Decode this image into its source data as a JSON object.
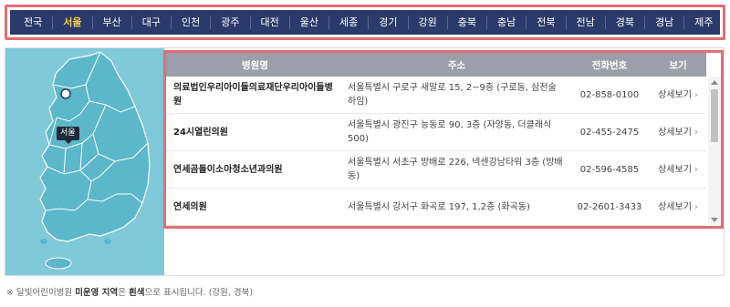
{
  "regions": {
    "tabs": [
      "전국",
      "서울",
      "부산",
      "대구",
      "인천",
      "광주",
      "대전",
      "울산",
      "세종",
      "경기",
      "강원",
      "충북",
      "충남",
      "전북",
      "전남",
      "경북",
      "경남",
      "제주"
    ],
    "active": "서울"
  },
  "map": {
    "tooltip": "서울"
  },
  "table": {
    "headers": {
      "name": "병원명",
      "address": "주소",
      "phone": "전화번호",
      "view": "보기"
    },
    "rows": [
      {
        "name": "의료법인우리아이들의료재단우리아이들병원",
        "address": "서울특별시 구로구 새말로 15, 2~9층 (구로동, 삼천술하임)",
        "phone": "02-858-0100",
        "view": "상세보기"
      },
      {
        "name": "24시열린의원",
        "address": "서울특별시 광진구 능동로 90, 3층 (자양동, 더클래식500)",
        "phone": "02-455-2475",
        "view": "상세보기"
      },
      {
        "name": "연세곰돌이소아청소년과의원",
        "address": "서울특별시 서초구 방배로 226, 넥센강남타워 3층 (방배동)",
        "phone": "02-596-4585",
        "view": "상세보기"
      },
      {
        "name": "연세의원",
        "address": "서울특별시 강서구 화곡로 197, 1,2층 (화곡동)",
        "phone": "02-2601-3433",
        "view": "상세보기"
      }
    ]
  },
  "note": {
    "prefix": "※ 달빛어린이병원 ",
    "emph1": "미운영 지역",
    "mid": "은 ",
    "emph2": "흰색",
    "suffix": "으로 표시됩니다. (강원, 경북)"
  },
  "colors": {
    "highlight_border": "#e36d74",
    "nav_bg": "#2b3a6b",
    "nav_active": "#f2d14a",
    "map_sea": "#7fc9d8",
    "map_land": "#5bb7c9",
    "table_header": "#9c9eaa"
  }
}
